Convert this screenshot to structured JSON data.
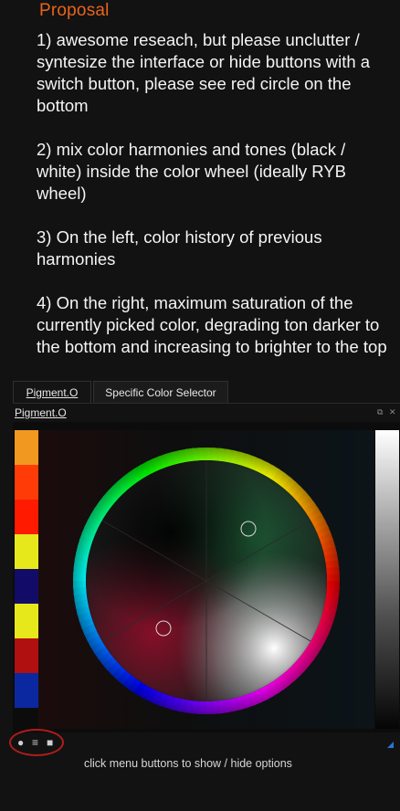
{
  "proposal": {
    "title": "Proposal",
    "points": [
      "1) awesome reseach, but please unclutter / syntesize the interface or hide buttons with a switch button, please see red circle on the bottom",
      "2) mix color harmonies and tones (black / white) inside the color wheel (ideally RYB wheel)",
      "3) On the left, color history of previous harmonies",
      "4) On the right, maximum saturation of the currently picked color, degrading ton darker to the bottom and increasing to brighter to the top"
    ]
  },
  "tabs": [
    {
      "label": "Pigment.O",
      "active": true
    },
    {
      "label": "Specific Color Selector",
      "active": false
    }
  ],
  "docker": {
    "title": "Pigment.O",
    "float_glyph": "⧉",
    "close_glyph": "✕"
  },
  "history": {
    "swatches": [
      "#f09820",
      "#ff3c08",
      "#ff1a00",
      "#e6e81c",
      "#120c68",
      "#e6e81c",
      "#b01010",
      "#0c28a0"
    ]
  },
  "wheel": {
    "picker_points": [
      {
        "hue": "green",
        "label": "harmony-handle-1"
      },
      {
        "hue": "red",
        "label": "harmony-handle-2"
      }
    ]
  },
  "menu": {
    "buttons": [
      "●",
      "≡",
      "■"
    ]
  },
  "caption": "click menu buttons to show / hide options",
  "colors": {
    "accent": "#e8641c",
    "highlight_ring": "#b01c1c",
    "background": "#121212"
  }
}
